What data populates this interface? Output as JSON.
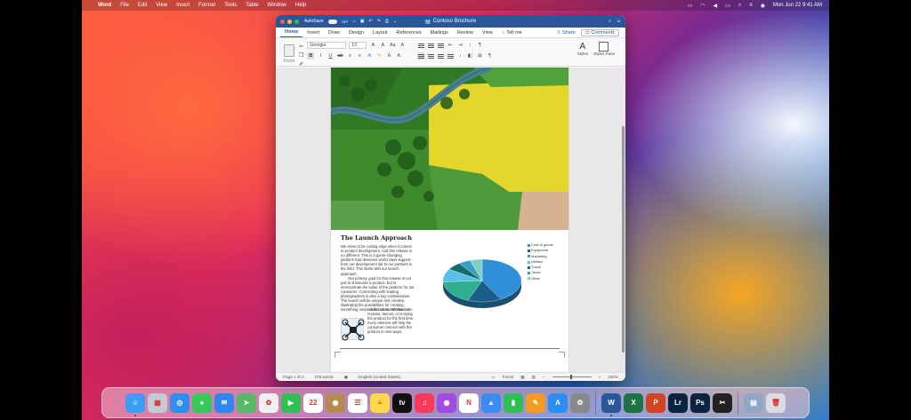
{
  "menubar": {
    "app": "Word",
    "items": [
      "File",
      "Edit",
      "View",
      "Insert",
      "Format",
      "Tools",
      "Table",
      "Window",
      "Help"
    ],
    "clock": "Mon Jun 22  9:41 AM"
  },
  "window": {
    "autosave_label": "AutoSave",
    "autosave_state": "OFF",
    "doc_title": "Contoso Brochure",
    "tabs": [
      "Home",
      "Insert",
      "Draw",
      "Design",
      "Layout",
      "References",
      "Mailings",
      "Review",
      "View"
    ],
    "tell_me": "Tell me",
    "share": "Share",
    "comments": "Comments"
  },
  "ribbon": {
    "paste_label": "Paste",
    "font_name": "Georgia",
    "font_size": "13",
    "styles_label": "Styles",
    "styles_pane_label": "Styles Pane"
  },
  "document": {
    "heading": "The Launch Approach",
    "para1": "We strive to be cutting edge when it comes to product development. And this release is no different. This is a game-changing platform that deserves world class support - from our development lab to our partners in the field. This starts with our launch approach.",
    "para2": "Our primary goal for this release is not just to showcase a product, but to demonstrate the value of the platform for our consumer. Connecting with leading photographers is also a key consideration. The launch will be unique and creative, illustrating the possibilities for creating something never seen before. Whether or",
    "para3": "not the consumer has seen reviews, demos, or is trying the product for the first time, every element will help the consumer connect with the product in new ways."
  },
  "chart_data": {
    "type": "pie",
    "categories": [
      "Cost of goods",
      "Equipment",
      "Marketing",
      "Utilities",
      "Travel",
      "Taxes",
      "Other"
    ],
    "values": [
      42,
      14,
      18,
      10,
      6,
      5,
      5
    ],
    "colors": [
      "#2f8fd8",
      "#1b5e8a",
      "#2db08f",
      "#5bc0e8",
      "#146b6b",
      "#3aa0c8",
      "#7fd0c0"
    ],
    "title": ""
  },
  "status": {
    "page": "Page 1 of 2",
    "words": "276 words",
    "language": "English (United States)",
    "focus": "Focus",
    "zoom": "100%"
  },
  "dock": {
    "apps": [
      {
        "icon": "finder-icon",
        "color": "#3a9ef5",
        "glyph": "☺"
      },
      {
        "icon": "launchpad-icon",
        "color": "#c6c9d6",
        "glyph": "▦"
      },
      {
        "icon": "safari-icon",
        "color": "#2d8ef0",
        "glyph": "◎"
      },
      {
        "icon": "messages-icon",
        "color": "#36c95a",
        "glyph": "●"
      },
      {
        "icon": "mail-icon",
        "color": "#2f86f0",
        "glyph": "✉"
      },
      {
        "icon": "maps-icon",
        "color": "#57b867",
        "glyph": "➤"
      },
      {
        "icon": "photos-icon",
        "color": "#f0f0f0",
        "glyph": "✿"
      },
      {
        "icon": "facetime-icon",
        "color": "#2fbf53",
        "glyph": "▶"
      },
      {
        "icon": "calendar-icon",
        "color": "#ffffff",
        "glyph": "22"
      },
      {
        "icon": "notes-app-icon",
        "color": "#b58a52",
        "glyph": "◉"
      },
      {
        "icon": "reminders-icon",
        "color": "#ffffff",
        "glyph": "☰"
      },
      {
        "icon": "notes-icon",
        "color": "#ffd84a",
        "glyph": "≡"
      },
      {
        "icon": "apple-tv-icon",
        "color": "#111111",
        "glyph": "tv"
      },
      {
        "icon": "music-icon",
        "color": "#fb3a5a",
        "glyph": "♫"
      },
      {
        "icon": "podcasts-icon",
        "color": "#a24be0",
        "glyph": "◉"
      },
      {
        "icon": "news-icon",
        "color": "#ffffff",
        "glyph": "N"
      },
      {
        "icon": "keynote-icon",
        "color": "#3b8bf0",
        "glyph": "▲"
      },
      {
        "icon": "numbers-icon",
        "color": "#2fbf53",
        "glyph": "▮"
      },
      {
        "icon": "pages-icon",
        "color": "#f59b22",
        "glyph": "✎"
      },
      {
        "icon": "app-store-icon",
        "color": "#2d8ef0",
        "glyph": "A"
      },
      {
        "icon": "system-preferences-icon",
        "color": "#888888",
        "glyph": "⚙"
      }
    ],
    "office_apps": [
      {
        "icon": "word-icon",
        "color": "#2b579a",
        "glyph": "W"
      },
      {
        "icon": "excel-icon",
        "color": "#1f7244",
        "glyph": "X"
      },
      {
        "icon": "powerpoint-icon",
        "color": "#d04423",
        "glyph": "P"
      },
      {
        "icon": "lightroom-icon",
        "color": "#0b2440",
        "glyph": "Lr"
      },
      {
        "icon": "photoshop-icon",
        "color": "#0b2440",
        "glyph": "Ps"
      },
      {
        "icon": "final-cut-icon",
        "color": "#222222",
        "glyph": "✂"
      }
    ],
    "extras": [
      {
        "icon": "downloads-folder-icon",
        "color": "#8fa8c8",
        "glyph": "▤"
      },
      {
        "icon": "trash-icon",
        "color": "#d8dde3",
        "glyph": "🗑"
      }
    ]
  }
}
